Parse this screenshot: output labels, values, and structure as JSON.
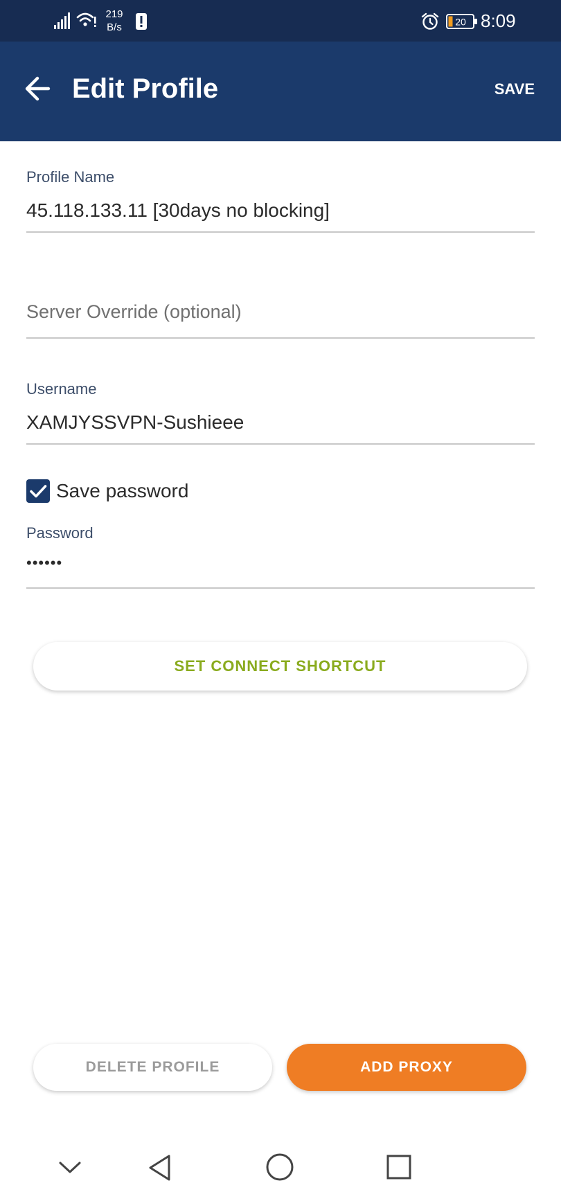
{
  "status_bar": {
    "net_speed_value": "219",
    "net_speed_unit": "B/s",
    "battery_level": "20",
    "time": "8:09"
  },
  "app_bar": {
    "back_icon": "arrow-left-icon",
    "title": "Edit Profile",
    "save_label": "SAVE"
  },
  "form": {
    "profile_name": {
      "label": "Profile Name",
      "value": "45.118.133.11 [30days no blocking]"
    },
    "server_override": {
      "placeholder": "Server Override (optional)",
      "value": ""
    },
    "username": {
      "label": "Username",
      "value": "XAMJYSSVPN-Sushieee"
    },
    "save_password": {
      "label": "Save password",
      "checked": true
    },
    "password": {
      "label": "Password",
      "value": "••••••"
    }
  },
  "buttons": {
    "set_connect_shortcut": "SET CONNECT SHORTCUT",
    "delete_profile": "DELETE PROFILE",
    "add_proxy": "ADD PROXY"
  },
  "nav_bar": {
    "icons": [
      "chevron-down-icon",
      "back-triangle-icon",
      "home-circle-icon",
      "recents-square-icon"
    ]
  },
  "colors": {
    "status_bar": "#172c52",
    "app_bar": "#1b3a6b",
    "accent_green": "#8aab1e",
    "accent_orange": "#ef7d24"
  }
}
